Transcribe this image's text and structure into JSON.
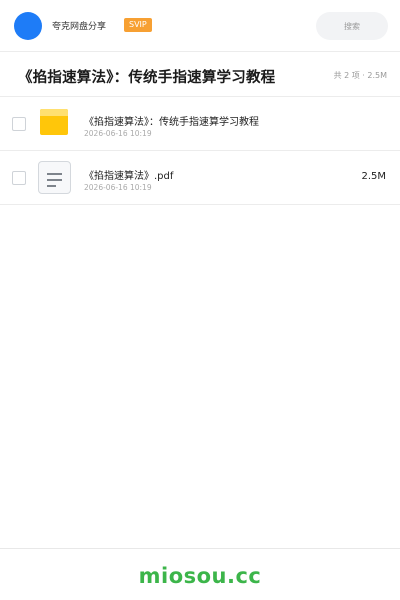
{
  "header": {
    "brand": "夸克网盘分享",
    "badge": "SVIP",
    "search_placeholder": "搜索"
  },
  "share": {
    "title": "《掐指速算法》：传统手指速算学习教程",
    "summary": "共 2 项 · 2.5M"
  },
  "files": [
    {
      "name": "《掐指速算法》：传统手指速算学习教程",
      "date": "2026-06-16 10:19",
      "size": "",
      "icon": "folder-icon"
    },
    {
      "name": "《掐指速算法》.pdf",
      "date": "2026-06-16 10:19",
      "size": "2.5M",
      "icon": "document-icon"
    }
  ],
  "footer": {
    "watermark": "miosou.cc"
  },
  "colors": {
    "accent": "#1e7cf7",
    "badge": "#f7a032",
    "folder": "#ffc60a",
    "watermark": "#3cb54a"
  }
}
